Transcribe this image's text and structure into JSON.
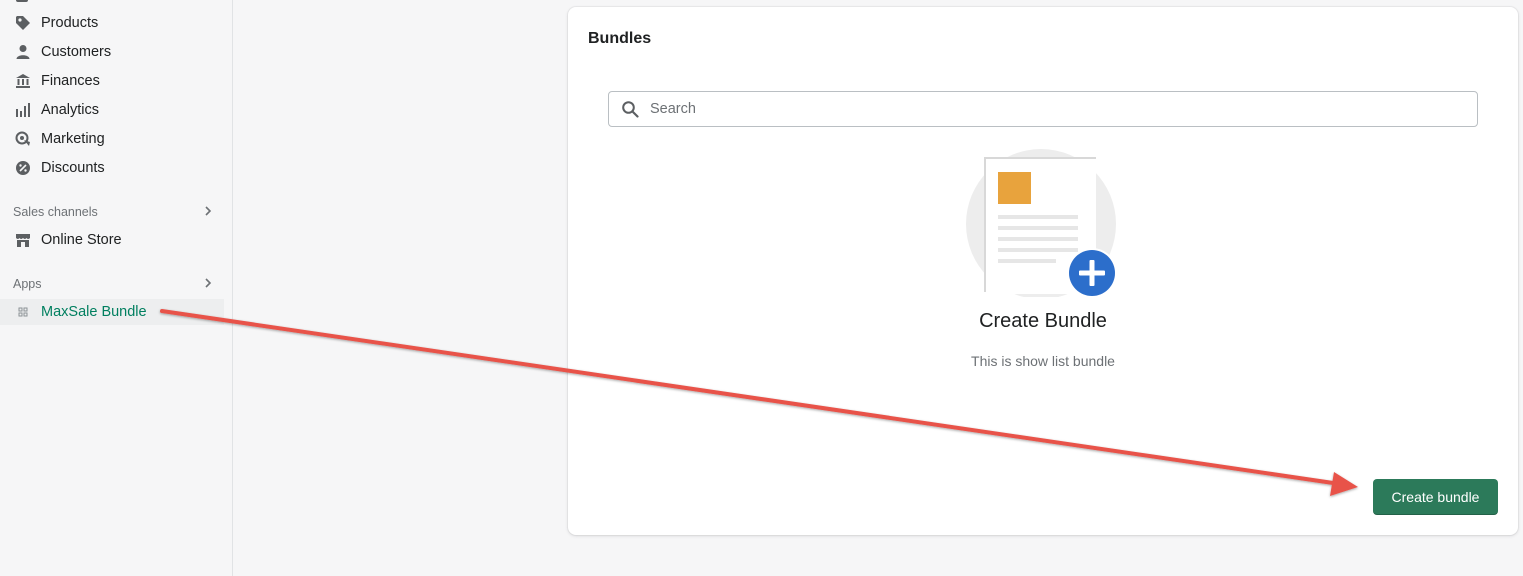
{
  "sidebar": {
    "items": [
      {
        "label": "Products",
        "icon": "tag-icon"
      },
      {
        "label": "Customers",
        "icon": "person-icon"
      },
      {
        "label": "Finances",
        "icon": "bank-icon"
      },
      {
        "label": "Analytics",
        "icon": "bar-chart-icon"
      },
      {
        "label": "Marketing",
        "icon": "target-icon"
      },
      {
        "label": "Discounts",
        "icon": "discount-icon"
      }
    ],
    "sales_channels_label": "Sales channels",
    "online_store_label": "Online Store",
    "apps_label": "Apps",
    "app_item_label": "MaxSale Bundle"
  },
  "main": {
    "title": "Bundles",
    "search": {
      "placeholder": "Search",
      "value": ""
    },
    "empty_state": {
      "heading": "Create Bundle",
      "description": "This is show list bundle"
    },
    "create_button_label": "Create bundle"
  },
  "colors": {
    "accent": "#2c7a5a",
    "active_nav_text": "#007f5f",
    "plus_badge": "#2c6ecb",
    "annotation_arrow": "#e8534a"
  }
}
